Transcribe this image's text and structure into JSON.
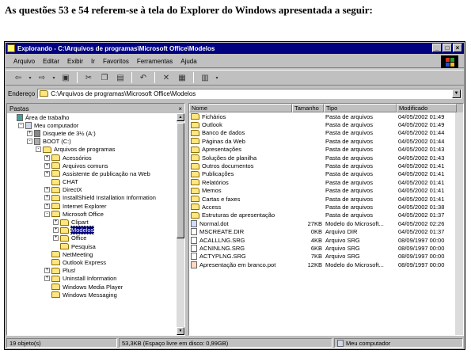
{
  "question": "As questões 53 e 54 referem-se à tela do Explorer do Windows apresentada a seguir:",
  "window": {
    "title": "Explorando - C:\\Arquivos de programas\\Microsoft Office\\Modelos"
  },
  "window_buttons": [
    "_",
    "□",
    "×"
  ],
  "menu": [
    "Arquivo",
    "Editar",
    "Exibir",
    "Ir",
    "Favoritos",
    "Ferramentas",
    "Ajuda"
  ],
  "address": {
    "label": "Endereço",
    "value": "C:\\Arquivos de programas\\Microsoft Office\\Modelos"
  },
  "folders_pane": {
    "title": "Pastas",
    "close": "×"
  },
  "tree": [
    {
      "label": "Área de trabalho",
      "level": 0,
      "box": "",
      "icon": "desktop-icon"
    },
    {
      "label": "Meu computador",
      "level": 1,
      "box": "-",
      "icon": "computer-icon"
    },
    {
      "label": "Disquete de 3½ (A:)",
      "level": 2,
      "box": "+",
      "icon": "floppy-icon"
    },
    {
      "label": "BOOT (C:)",
      "level": 2,
      "box": "-",
      "icon": "drive-icon"
    },
    {
      "label": "Arquivos de programas",
      "level": 3,
      "box": "-",
      "icon": "folder-icon"
    },
    {
      "label": "Acessórios",
      "level": 4,
      "box": "+",
      "icon": "folder-icon"
    },
    {
      "label": "Arquivos comuns",
      "level": 4,
      "box": "+",
      "icon": "folder-icon"
    },
    {
      "label": "Assistente de publicação na Web",
      "level": 4,
      "box": "+",
      "icon": "folder-icon"
    },
    {
      "label": "CHAT",
      "level": 4,
      "box": "",
      "icon": "folder-icon"
    },
    {
      "label": "DirectX",
      "level": 4,
      "box": "+",
      "icon": "folder-icon"
    },
    {
      "label": "InstallShield Installation Information",
      "level": 4,
      "box": "+",
      "icon": "folder-icon"
    },
    {
      "label": "Internet Explorer",
      "level": 4,
      "box": "+",
      "icon": "folder-icon"
    },
    {
      "label": "Microsoft Office",
      "level": 4,
      "box": "-",
      "icon": "folder-icon"
    },
    {
      "label": "Clipart",
      "level": 5,
      "box": "+",
      "icon": "folder-icon"
    },
    {
      "label": "Modelos",
      "level": 5,
      "box": "+",
      "icon": "folder-icon",
      "selected": true
    },
    {
      "label": "Office",
      "level": 5,
      "box": "+",
      "icon": "folder-icon"
    },
    {
      "label": "Pesquisa",
      "level": 5,
      "box": "",
      "icon": "folder-icon"
    },
    {
      "label": "NetMeeting",
      "level": 4,
      "box": "",
      "icon": "folder-icon"
    },
    {
      "label": "Outlook Express",
      "level": 4,
      "box": "",
      "icon": "folder-icon"
    },
    {
      "label": "Plus!",
      "level": 4,
      "box": "+",
      "icon": "folder-icon"
    },
    {
      "label": "Uninstall Information",
      "level": 4,
      "box": "+",
      "icon": "folder-icon"
    },
    {
      "label": "Windows Media Player",
      "level": 4,
      "box": "",
      "icon": "folder-icon"
    },
    {
      "label": "Windows Messaging",
      "level": 4,
      "box": "",
      "icon": "folder-icon"
    }
  ],
  "columns": [
    "Nome",
    "Tamanho",
    "Tipo",
    "Modificado"
  ],
  "files": [
    {
      "name": "Fichários",
      "size": "",
      "type": "Pasta de arquivos",
      "modified": "04/05/2002 01:49",
      "icon": "folder-icon"
    },
    {
      "name": "Outlook",
      "size": "",
      "type": "Pasta de arquivos",
      "modified": "04/05/2002 01:49",
      "icon": "folder-icon"
    },
    {
      "name": "Banco de dados",
      "size": "",
      "type": "Pasta de arquivos",
      "modified": "04/05/2002 01:44",
      "icon": "folder-icon"
    },
    {
      "name": "Páginas da Web",
      "size": "",
      "type": "Pasta de arquivos",
      "modified": "04/05/2002 01:44",
      "icon": "folder-icon"
    },
    {
      "name": "Apresentações",
      "size": "",
      "type": "Pasta de arquivos",
      "modified": "04/05/2002 01:43",
      "icon": "folder-icon"
    },
    {
      "name": "Soluções de planilha",
      "size": "",
      "type": "Pasta de arquivos",
      "modified": "04/05/2002 01:43",
      "icon": "folder-icon"
    },
    {
      "name": "Outros documentos",
      "size": "",
      "type": "Pasta de arquivos",
      "modified": "04/05/2002 01:41",
      "icon": "folder-icon"
    },
    {
      "name": "Publicações",
      "size": "",
      "type": "Pasta de arquivos",
      "modified": "04/05/2002 01:41",
      "icon": "folder-icon"
    },
    {
      "name": "Relatórios",
      "size": "",
      "type": "Pasta de arquivos",
      "modified": "04/05/2002 01:41",
      "icon": "folder-icon"
    },
    {
      "name": "Memos",
      "size": "",
      "type": "Pasta de arquivos",
      "modified": "04/05/2002 01:41",
      "icon": "folder-icon"
    },
    {
      "name": "Cartas e faxes",
      "size": "",
      "type": "Pasta de arquivos",
      "modified": "04/05/2002 01:41",
      "icon": "folder-icon"
    },
    {
      "name": "Access",
      "size": "",
      "type": "Pasta de arquivos",
      "modified": "04/05/2002 01:38",
      "icon": "folder-icon"
    },
    {
      "name": "Estruturas de apresentação",
      "size": "",
      "type": "Pasta de arquivos",
      "modified": "04/05/2002 01:37",
      "icon": "folder-icon"
    },
    {
      "name": "Normal.dot",
      "size": "27KB",
      "type": "Modelo do Microsoft...",
      "modified": "04/05/2002 02:26",
      "icon": "word-template-icon"
    },
    {
      "name": "MSCREATE.DIR",
      "size": "0KB",
      "type": "Arquivo DIR",
      "modified": "04/05/2002 01:37",
      "icon": "file-icon"
    },
    {
      "name": "ACALLLNG.SRG",
      "size": "4KB",
      "type": "Arquivo SRG",
      "modified": "08/09/1997 00:00",
      "icon": "file-icon"
    },
    {
      "name": "ACNINLNG.SRG",
      "size": "6KB",
      "type": "Arquivo SRG",
      "modified": "08/09/1997 00:00",
      "icon": "file-icon"
    },
    {
      "name": "ACTYPLNG.SRG",
      "size": "7KB",
      "type": "Arquivo SRG",
      "modified": "08/09/1997 00:00",
      "icon": "file-icon"
    },
    {
      "name": "Apresentação em branco.pot",
      "size": "12KB",
      "type": "Modelo do Microsoft...",
      "modified": "08/09/1997 00:00",
      "icon": "ppt-template-icon"
    }
  ],
  "status": {
    "objects": "19 objeto(s)",
    "size": "53,3KB (Espaço livre em disco: 0,99GB)",
    "location": "Meu computador"
  }
}
